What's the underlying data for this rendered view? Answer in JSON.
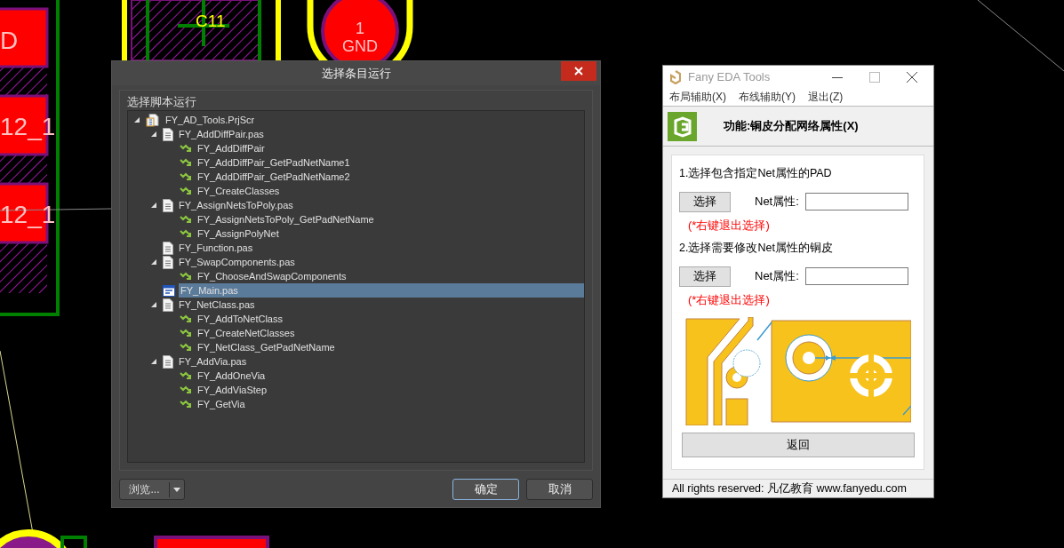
{
  "pcb": {
    "labels": [
      {
        "text": "D"
      },
      {
        "text": "12_1"
      },
      {
        "text": "12_1"
      },
      {
        "text": "C11"
      },
      {
        "text": "1"
      },
      {
        "text": "GND"
      }
    ]
  },
  "dialog": {
    "title": "选择条目运行",
    "section_label": "选择脚本运行",
    "tree": [
      {
        "label": "FY_AD_Tools.PrjScr",
        "kind": "project",
        "expanded": true,
        "selected": false,
        "children": [
          {
            "label": "FY_AddDiffPair.pas",
            "kind": "file",
            "expanded": true,
            "selected": false,
            "children": [
              {
                "label": "FY_AddDiffPair",
                "kind": "procedure",
                "selected": false
              },
              {
                "label": "FY_AddDiffPair_GetPadNetName1",
                "kind": "procedure",
                "selected": false
              },
              {
                "label": "FY_AddDiffPair_GetPadNetName2",
                "kind": "procedure",
                "selected": false
              },
              {
                "label": "FY_CreateClasses",
                "kind": "procedure",
                "selected": false
              }
            ]
          },
          {
            "label": "FY_AssignNetsToPoly.pas",
            "kind": "file",
            "expanded": true,
            "selected": false,
            "children": [
              {
                "label": "FY_AssignNetsToPoly_GetPadNetName",
                "kind": "procedure",
                "selected": false
              },
              {
                "label": "FY_AssignPolyNet",
                "kind": "procedure",
                "selected": false
              }
            ]
          },
          {
            "label": "FY_Function.pas",
            "kind": "file",
            "selected": false
          },
          {
            "label": "FY_SwapComponents.pas",
            "kind": "file",
            "expanded": true,
            "selected": false,
            "children": [
              {
                "label": "FY_ChooseAndSwapComponents",
                "kind": "procedure",
                "selected": false
              }
            ]
          },
          {
            "label": "FY_Main.pas",
            "kind": "form",
            "selected": true
          },
          {
            "label": "FY_NetClass.pas",
            "kind": "file",
            "expanded": true,
            "selected": false,
            "children": [
              {
                "label": "FY_AddToNetClass",
                "kind": "procedure",
                "selected": false
              },
              {
                "label": "FY_CreateNetClasses",
                "kind": "procedure",
                "selected": false
              },
              {
                "label": "FY_NetClass_GetPadNetName",
                "kind": "procedure",
                "selected": false
              }
            ]
          },
          {
            "label": "FY_AddVia.pas",
            "kind": "file",
            "expanded": true,
            "selected": false,
            "children": [
              {
                "label": "FY_AddOneVia",
                "kind": "procedure",
                "selected": false
              },
              {
                "label": "FY_AddViaStep",
                "kind": "procedure",
                "selected": false
              },
              {
                "label": "FY_GetVia",
                "kind": "procedure",
                "selected": false
              }
            ]
          }
        ]
      }
    ],
    "browse_button": "浏览...",
    "ok_button": "确定",
    "cancel_button": "取消"
  },
  "tool_window": {
    "title": "Fany EDA Tools",
    "menu": [
      "布局辅助(X)",
      "布线辅助(Y)",
      "退出(Z)"
    ],
    "header": "功能:铜皮分配网络属性(X)",
    "steps": [
      {
        "label": "1.选择包含指定Net属性的PAD",
        "button": "选择",
        "field_label": "Net属性:",
        "hint": "(*右键退出选择)"
      },
      {
        "label": "2.选择需要修改Net属性的铜皮",
        "button": "选择",
        "field_label": "Net属性:",
        "hint": "(*右键退出选择)"
      }
    ],
    "back_button": "返回",
    "status": "All rights reserved: 凡亿教育 www.fanyedu.com"
  }
}
